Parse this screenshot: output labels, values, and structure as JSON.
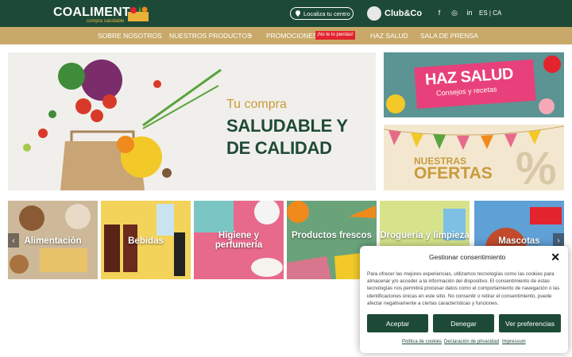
{
  "header": {
    "brand": "COALIMENT",
    "brand_tagline": "compra saludable",
    "locate_label": "Localiza tu centro",
    "club_label": "Club&Co",
    "social": [
      "f",
      "◎",
      "in"
    ],
    "lang": "ES | CA"
  },
  "nav": {
    "items": [
      "SOBRE NOSOTROS",
      "NUESTROS PRODUCTOS",
      "PROMOCIONES",
      "HAZ SALUD",
      "SALA DE PRENSA"
    ],
    "promo_badge": "¡No te lo pierdas!",
    "dropdown_icon": "⌄"
  },
  "hero": {
    "line1": "Tu compra",
    "line2": "SALUDABLE Y",
    "line3": "DE CALIDAD"
  },
  "side_banners": {
    "haz_salud": {
      "title": "HAZ SALUD",
      "subtitle": "Consejos y recetas"
    },
    "ofertas": {
      "title1": "NUESTRAS",
      "title2": "OFERTAS",
      "symbol": "%"
    }
  },
  "categories": [
    {
      "label": "Alimentación"
    },
    {
      "label": "Bebidas"
    },
    {
      "label": "Higiene y perfumería"
    },
    {
      "label": "Productos frescos"
    },
    {
      "label": "Droguería y limpieza"
    },
    {
      "label": "Mascotas"
    }
  ],
  "carousel": {
    "prev": "‹",
    "next": "›"
  },
  "consent": {
    "title": "Gestionar consentimiento",
    "close": "✕",
    "body": "Para ofrecer las mejores experiencias, utilizamos tecnologías como las cookies para almacenar y/o acceder a la información del dispositivo. El consentimiento de estas tecnologías nos permitirá procesar datos como el comportamiento de navegación o las identificaciones únicas en este sitio. No consentir o retirar el consentimiento, puede afectar negativamente a ciertas características y funciones.",
    "accept": "Aceptar",
    "deny": "Denegar",
    "prefs": "Ver preferencias",
    "links": [
      "Política de cookies",
      "Declaración de privacidad",
      "Impressum"
    ]
  },
  "colors": {
    "brand_green": "#1d4a36",
    "gold": "#c8a969",
    "accent_red": "#e3232d"
  }
}
